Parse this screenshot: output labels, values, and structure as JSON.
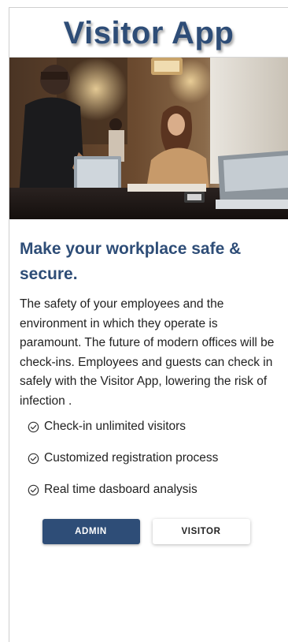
{
  "header": {
    "title": "Visitor App"
  },
  "hero": {
    "image": "office-checkin-photo"
  },
  "main": {
    "headline": "Make your workplace safe & secure.",
    "description": "The safety of your employees and the environment in which they operate is paramount. The future of modern offices will be check-ins. Employees and guests can check in safely with the Visitor App, lowering the risk of infection .",
    "features": [
      {
        "icon": "check-circle-icon",
        "label": "Check-in unlimited visitors"
      },
      {
        "icon": "check-circle-icon",
        "label": "Customized registration process"
      },
      {
        "icon": "check-circle-icon",
        "label": "Real time dasboard analysis"
      }
    ]
  },
  "actions": {
    "admin_label": "ADMIN",
    "visitor_label": "VISITOR"
  },
  "colors": {
    "brand": "#2e4d77",
    "text": "#222222"
  }
}
